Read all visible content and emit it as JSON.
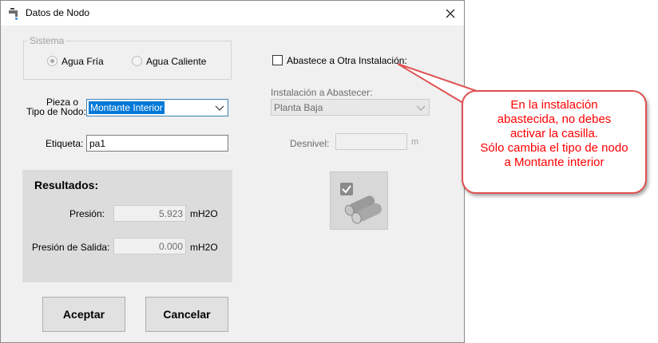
{
  "window": {
    "title": "Datos de Nodo"
  },
  "sistema": {
    "legend": "Sistema",
    "options": [
      "Agua Fría",
      "Agua Caliente"
    ],
    "selected": "Agua Fría"
  },
  "form": {
    "pieza_label_1": "Pieza o",
    "pieza_label_2": "Tipo de Nodo:",
    "pieza_value": "Montante Interior",
    "etiqueta_label": "Etiqueta:",
    "etiqueta_value": "pa1",
    "abastece_label": "Abastece a Otra Instalación:",
    "abastece_checked": false,
    "instalacion_label": "Instalación a Abastecer:",
    "instalacion_value": "Planta Baja",
    "desnivel_label": "Desnivel:",
    "desnivel_value": "",
    "desnivel_unit": "m"
  },
  "results": {
    "title": "Resultados:",
    "presion_label": "Presión:",
    "presion_value": "5.923",
    "presion_unit": "mH2O",
    "presion_salida_label": "Presión de Salida:",
    "presion_salida_value": "0.000",
    "presion_salida_unit": "mH2O"
  },
  "buttons": {
    "accept": "Aceptar",
    "cancel": "Cancelar"
  },
  "callout": {
    "lines": [
      "En la instalación",
      "abastecida, no debes",
      "activar la casilla.",
      "Sólo cambia el tipo de nodo",
      "a Montante interior"
    ]
  },
  "colors": {
    "callout_border": "#e05050",
    "callout_text": "#ff0000",
    "selection": "#0078d7"
  }
}
